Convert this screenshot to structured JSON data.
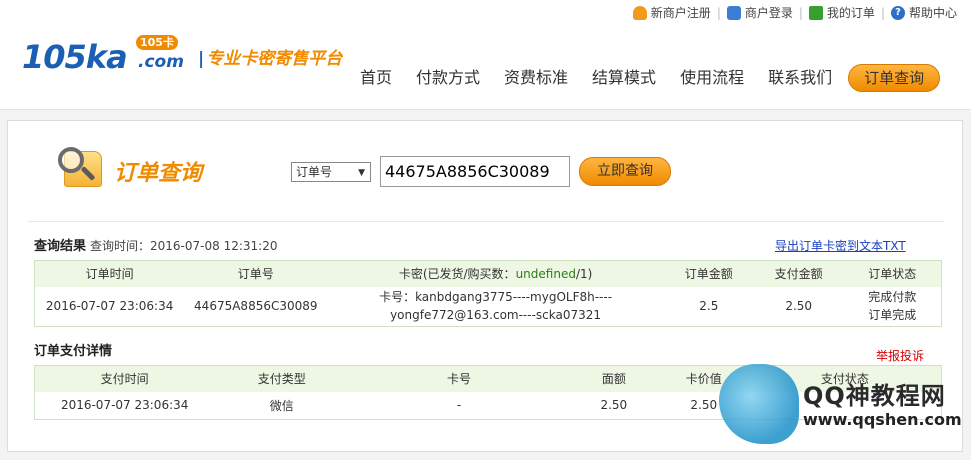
{
  "header": {
    "toplinks": [
      "新商户注册",
      "商户登录",
      "我的订单",
      "帮助中心"
    ],
    "logo": {
      "main": "105ka",
      "com": ".com",
      "badge": "105卡",
      "slogan": "专业卡密寄售平台"
    },
    "nav": [
      "首页",
      "付款方式",
      "资费标准",
      "结算模式",
      "使用流程",
      "联系我们"
    ],
    "nav_button": "订单查询"
  },
  "query": {
    "title": "订单查询",
    "select_value": "订单号",
    "input_value": "44675A8856C30089",
    "button": "立即查询"
  },
  "result": {
    "heading": "查询结果",
    "time_label": "查询时间：2016-07-08 12:31:20",
    "export_link": "导出订单卡密到文本TXT",
    "columns": [
      "订单时间",
      "订单号",
      "卡密(已发货/购买数：undefined/1)",
      "订单金额",
      "支付金额",
      "订单状态"
    ],
    "row": {
      "time": "2016-07-07 23:06:34",
      "order_no": "44675A8856C30089",
      "card_line1": "卡号：kanbdgang3775----mygOLF8h----",
      "card_line2": "yongfe772@163.com----scka07321",
      "order_amount": "2.5",
      "pay_amount": "2.50",
      "status_line1": "完成付款",
      "status_line2": "订单完成"
    }
  },
  "payment": {
    "heading": "订单支付详情",
    "report_link": "举报投诉",
    "columns": [
      "支付时间",
      "支付类型",
      "卡号",
      "面额",
      "卡价值",
      "支付状态"
    ],
    "row": {
      "time": "2016-07-07 23:06:34",
      "type": "微信",
      "card_no": "-",
      "face_value": "2.50",
      "card_value": "2.50",
      "status": ""
    }
  },
  "watermark": {
    "text": "QQ神教程网",
    "url": "www.qqshen.com"
  },
  "colors": {
    "accent": "#f08a00",
    "brand": "#1a5fb4",
    "table_header": "#eef6e4"
  }
}
